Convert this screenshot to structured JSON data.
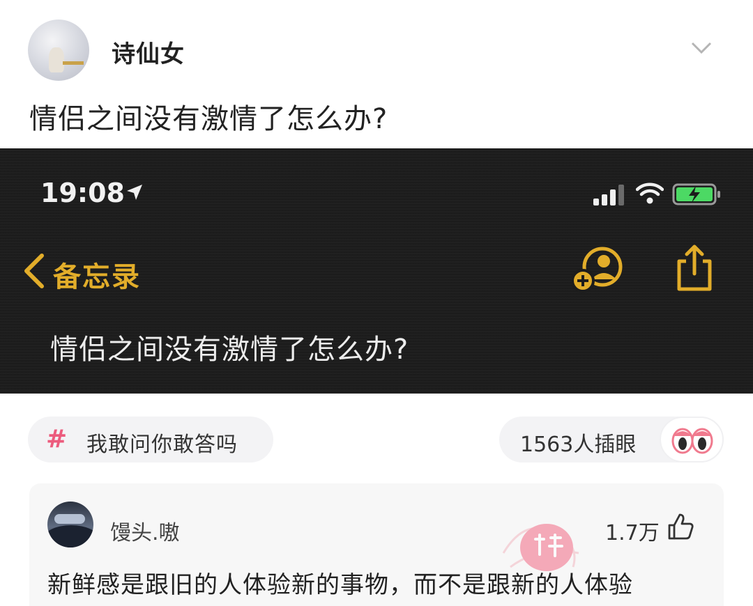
{
  "post": {
    "author_name": "诗仙女",
    "question": "情侣之间没有激情了怎么办?"
  },
  "screenshot": {
    "status_time": "19:08",
    "back_label": "备忘录",
    "note_title": "情侣之间没有激情了怎么办?",
    "accent_color": "#e2ad2a"
  },
  "topic": {
    "hash_symbol": "#",
    "label": "我敢问你敢答吗"
  },
  "stats": {
    "text": "1563人插眼"
  },
  "comment": {
    "author": "馒头.嗷",
    "likes": "1.7万",
    "text": "新鲜感是跟旧的人体验新的事物，而不是跟新的人体验"
  },
  "icons": [
    "chevron-down-icon",
    "location-arrow-icon",
    "cellular-signal-icon",
    "wifi-icon",
    "battery-charging-icon",
    "back-chevron-icon",
    "add-person-icon",
    "share-icon",
    "hashtag-icon",
    "eyes-icon",
    "thumbs-up-icon",
    "stamp-watermark-icon"
  ]
}
